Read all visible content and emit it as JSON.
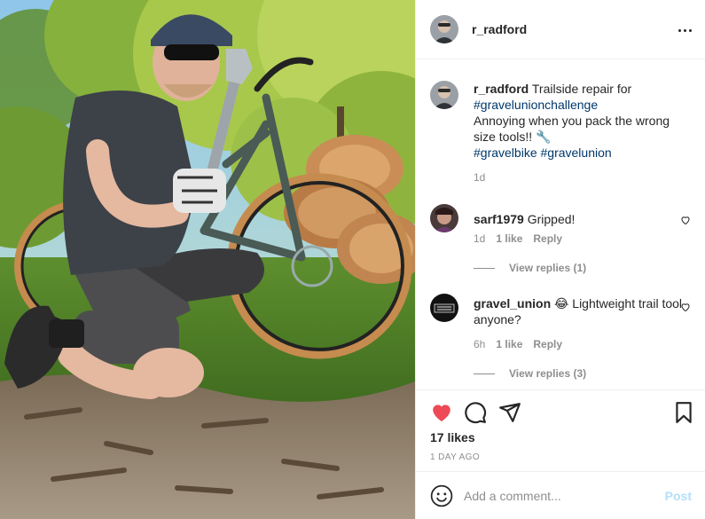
{
  "post": {
    "author": "r_radford",
    "more_icon": "more-horizontal-icon"
  },
  "caption": {
    "author": "r_radford",
    "text_1": "Trailside repair for",
    "tag_1": "#gravelunionchallenge",
    "text_2": "Annoying when you pack the wrong size tools!! 🔧",
    "tag_2": "#gravelbike",
    "tag_3": "#gravelunion",
    "age": "1d"
  },
  "comments": [
    {
      "author": "sarf1979",
      "text": "Gripped!",
      "age": "1d",
      "likes": "1 like",
      "reply": "Reply",
      "view_replies": "View replies (1)"
    },
    {
      "author": "gravel_union",
      "text": "😂 Lightweight trail tool anyone?",
      "age": "6h",
      "likes": "1 like",
      "reply": "Reply",
      "view_replies": "View replies (3)"
    }
  ],
  "actions": {
    "likes": "17 likes",
    "date": "1 DAY AGO",
    "liked_color": "#ed4956"
  },
  "add_comment": {
    "placeholder": "Add a comment...",
    "post_label": "Post"
  },
  "colors": {
    "text": "#262626",
    "muted": "#8e8e8e",
    "link": "#00376b",
    "post_disabled": "#b2dffc",
    "border": "#efefef"
  }
}
